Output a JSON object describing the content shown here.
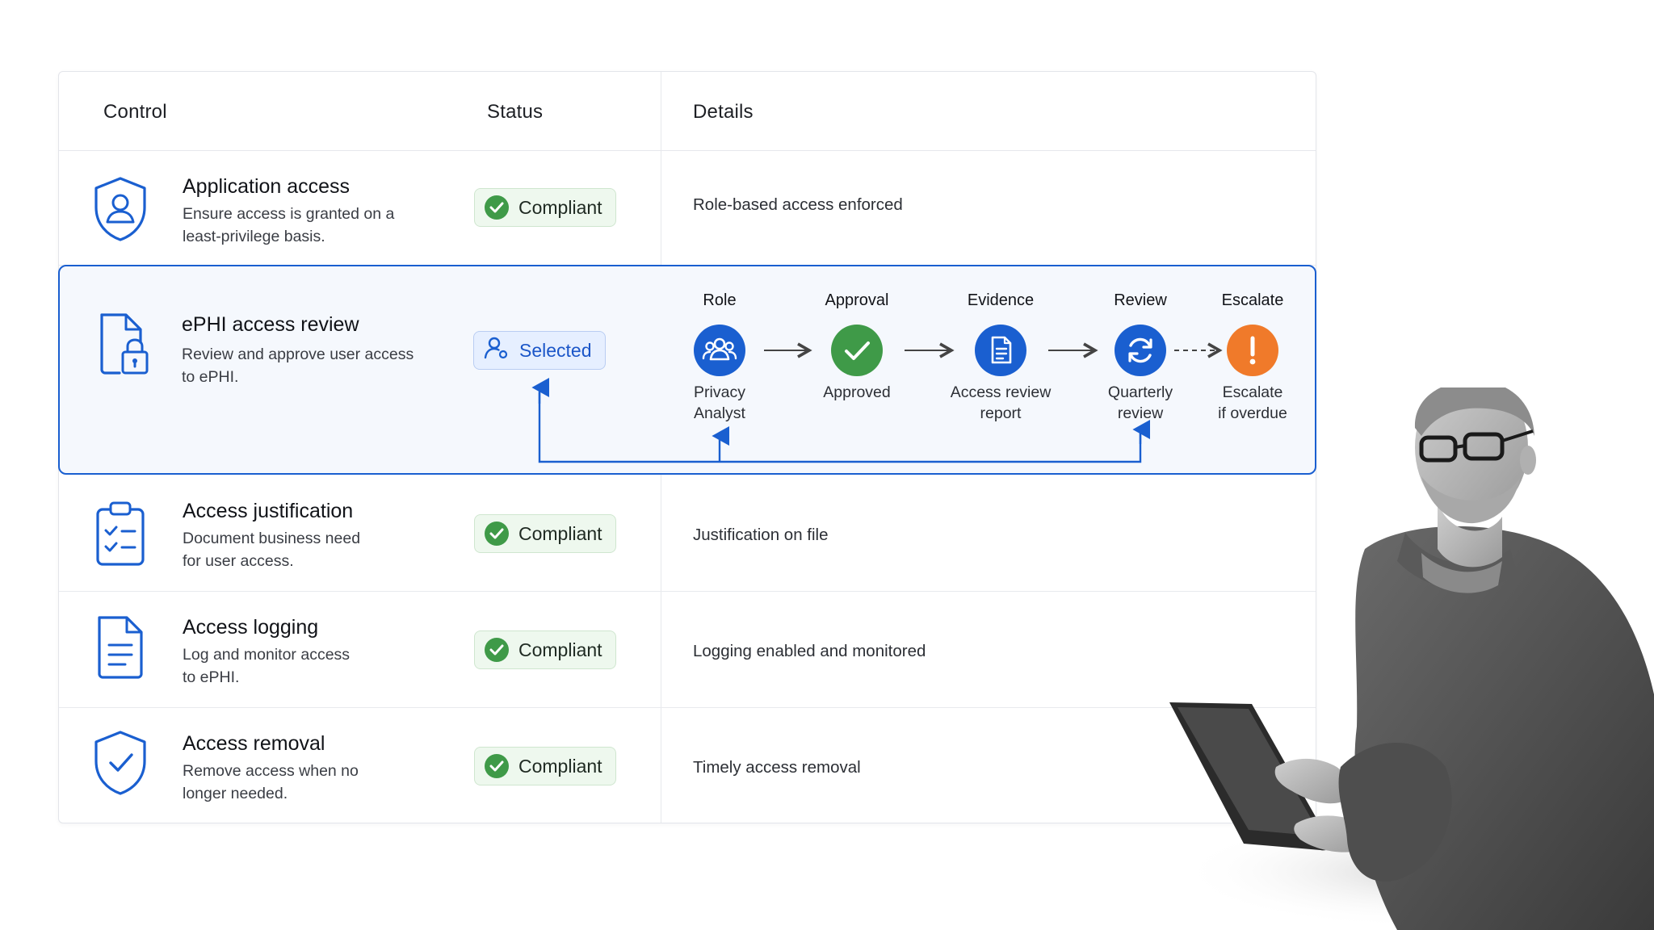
{
  "table": {
    "headers": {
      "control": "Control",
      "status": "Status",
      "details": "Details"
    },
    "rows": [
      {
        "title": "Application access",
        "desc_line1": "Ensure access is granted on a",
        "desc_line2": "least-privilege basis.",
        "status": "Compliant",
        "details": "Role-based access enforced",
        "icon": "user-shield-icon"
      },
      {
        "title": "ePHI access review",
        "desc_line1": "Review and approve user access",
        "desc_line2": "to ePHI.",
        "status": "Selected",
        "icon": "locked-file-icon"
      },
      {
        "title": "Access justification",
        "desc_line1": "Document business need",
        "desc_line2": "for user access.",
        "status": "Compliant",
        "details": "Justification on file",
        "icon": "clipboard-checklist-icon"
      },
      {
        "title": "Access logging",
        "desc_line1": "Log and monitor access",
        "desc_line2": "to ePHI.",
        "status": "Compliant",
        "details": "Logging enabled and monitored",
        "icon": "document-icon"
      },
      {
        "title": "Access removal",
        "desc_line1": "Remove access when no",
        "desc_line2": "longer needed.",
        "status": "Compliant",
        "details": "Timely access removal",
        "icon": "shield-check-icon"
      }
    ]
  },
  "workflow": {
    "steps": [
      {
        "head": "Role",
        "line1": "Privacy",
        "line2": "Analyst",
        "icon": "users-icon",
        "color": "#1a5fd0"
      },
      {
        "head": "Approval",
        "line1": "Approved",
        "line2": "",
        "icon": "check-icon",
        "color": "#3f9a48"
      },
      {
        "head": "Evidence",
        "line1": "Access review",
        "line2": "report",
        "icon": "report-icon",
        "color": "#1a5fd0"
      },
      {
        "head": "Review",
        "line1": "Quarterly",
        "line2": "review",
        "icon": "refresh-icon",
        "color": "#1a5fd0"
      },
      {
        "head": "Escalate",
        "line1": "Escalate",
        "line2": "if overdue",
        "icon": "alert-icon",
        "color": "#f07a2a"
      }
    ]
  },
  "colors": {
    "accent": "#1a5fd0",
    "success": "#3f9a48",
    "warning": "#f07a2a"
  }
}
